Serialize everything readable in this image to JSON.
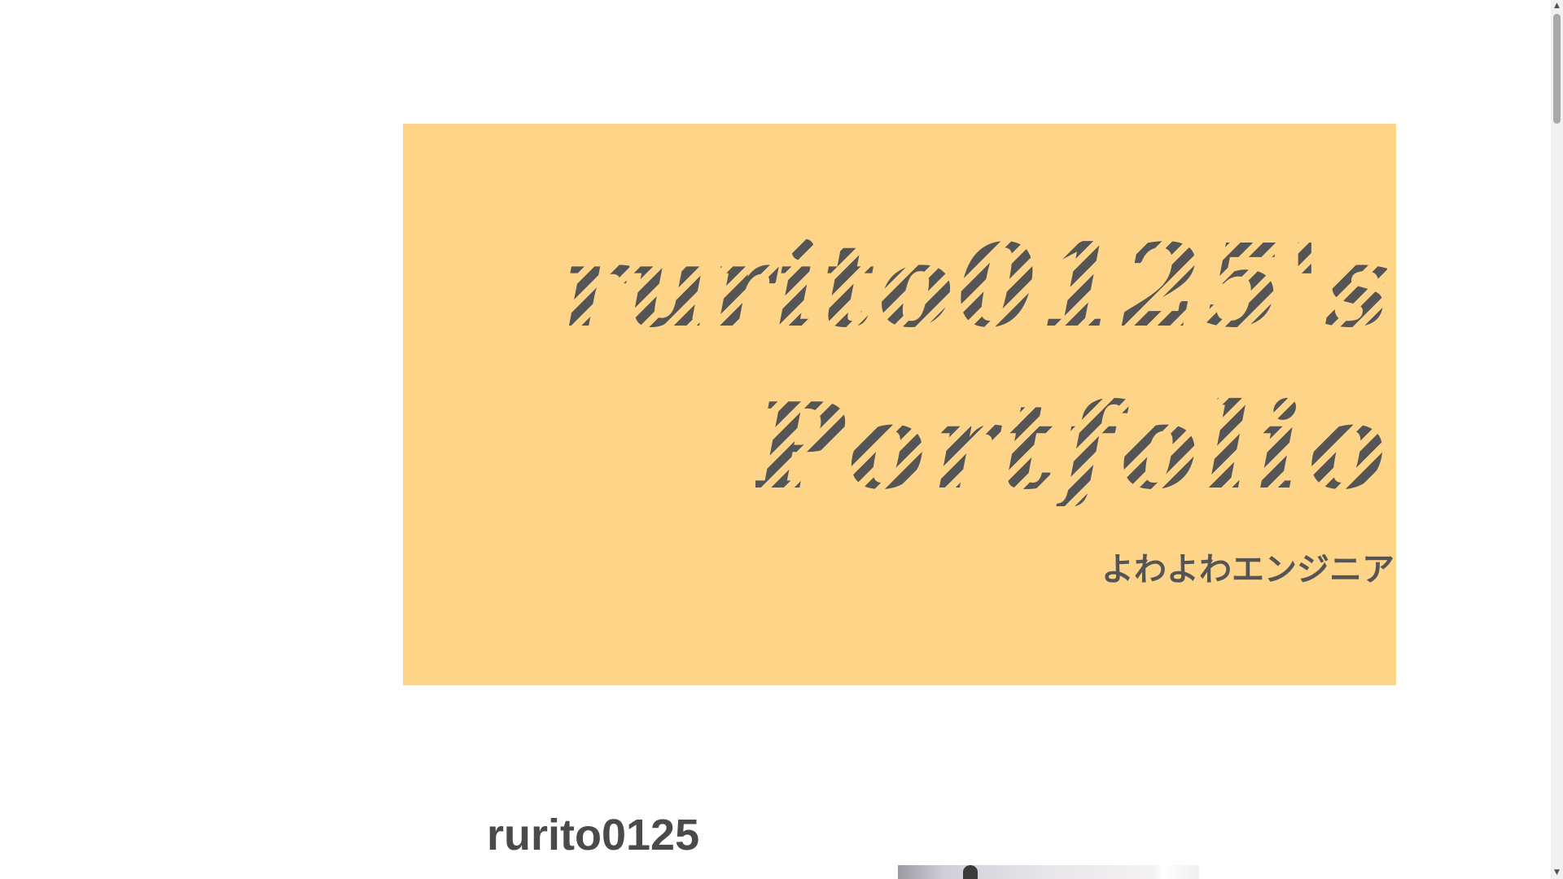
{
  "hero": {
    "title_line1": "rurito0125's",
    "title_line2": "Portfolio",
    "subtitle": "よわよわエンジニア",
    "background_color": "#fdd488",
    "text_color": "#555555"
  },
  "profile": {
    "name": "rurito0125"
  },
  "scrollbar": {
    "up_icon": "▲",
    "down_icon": "▼"
  }
}
